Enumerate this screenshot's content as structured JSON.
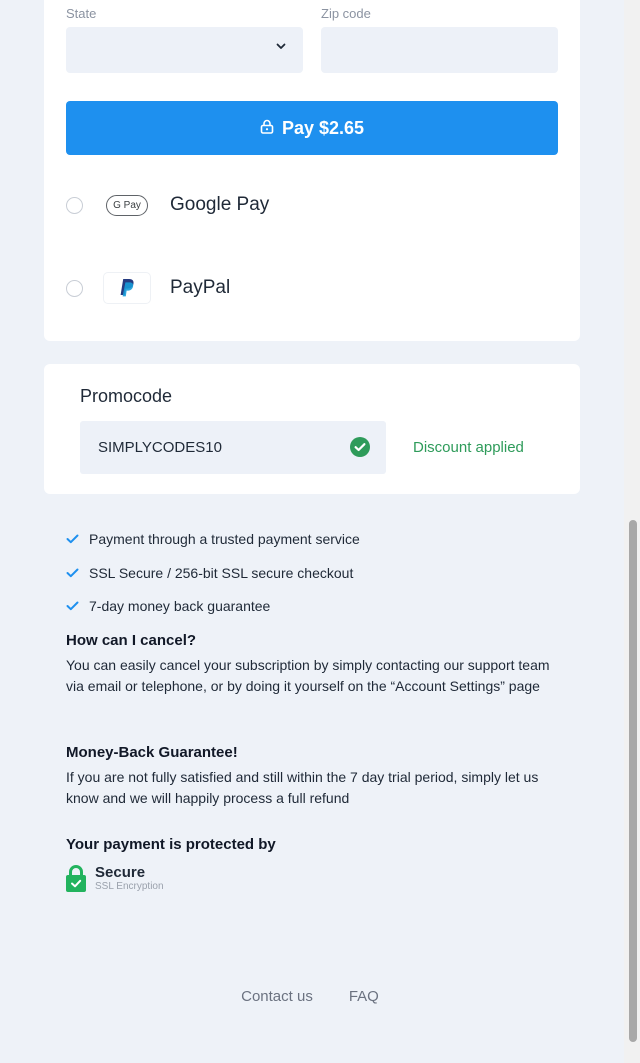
{
  "address": {
    "state_label": "State",
    "state_value": "",
    "zip_label": "Zip code",
    "zip_value": ""
  },
  "pay_button": {
    "label": "Pay $2.65",
    "icon": "lock-icon"
  },
  "payment_methods": [
    {
      "label": "Google Pay",
      "logo_text": "G Pay",
      "icon": "google-pay-logo"
    },
    {
      "label": "PayPal",
      "logo_text": "P",
      "icon": "paypal-logo"
    }
  ],
  "promo": {
    "title": "Promocode",
    "code": "SIMPLYCODES10",
    "status": "Discount applied",
    "status_icon": "check-circle-icon"
  },
  "features": [
    "Payment through a trusted payment service",
    "SSL Secure / 256-bit SSL secure checkout",
    "7-day money back guarantee"
  ],
  "faq": [
    {
      "question": "How can I cancel?",
      "answer": "You can easily cancel your subscription by simply contacting our support team via email or telephone, or by doing it yourself on the “Account Settings” page"
    },
    {
      "question": "Money-Back Guarantee!",
      "answer": "If you are not fully satisfied and still within the 7 day trial period, simply let us know and we will happily process a full refund"
    }
  ],
  "protection": {
    "heading": "Your payment is protected by",
    "badge_title": "Secure",
    "badge_subtitle": "SSL Encryption"
  },
  "footer": {
    "links": [
      "Contact us",
      "FAQ"
    ]
  },
  "colors": {
    "accent": "#1e90ef",
    "success": "#2e9b5a",
    "background": "#eef2f8",
    "check": "#1e90ef"
  }
}
